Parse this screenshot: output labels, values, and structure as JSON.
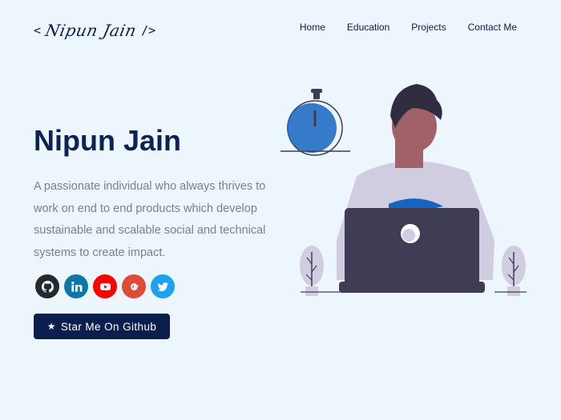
{
  "logo": {
    "open_bracket": "<",
    "signature": "Nipun Jain",
    "close_bracket": "/>"
  },
  "nav": {
    "items": [
      "Home",
      "Education",
      "Projects",
      "Contact Me"
    ]
  },
  "hero": {
    "name": "Nipun Jain",
    "description": "A passionate individual who always thrives to work on end to end products which develop sustainable and scalable social and technical systems to create impact."
  },
  "socials": [
    {
      "icon": "github-icon",
      "color": "#24292e"
    },
    {
      "icon": "linkedin-icon",
      "color": "#0e76a8"
    },
    {
      "icon": "youtube-icon",
      "color": "#ff0000"
    },
    {
      "icon": "google-icon",
      "color": "#dd4b39"
    },
    {
      "icon": "twitter-icon",
      "color": "#1da1f2"
    }
  ],
  "cta": {
    "icon": "star-icon",
    "label": "Star Me On Github"
  },
  "colors": {
    "background": "#eef6fd",
    "primary": "#0b1f4f",
    "text_muted": "#7b7f8c"
  }
}
